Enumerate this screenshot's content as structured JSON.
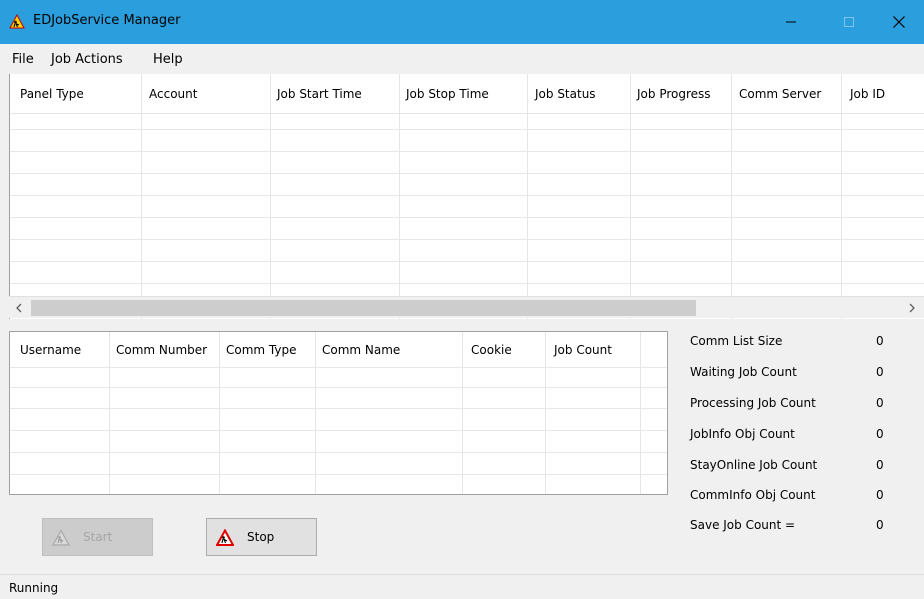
{
  "window": {
    "title": "EDJobService Manager"
  },
  "menu": [
    "File",
    "Job Actions",
    "Help"
  ],
  "jobs_grid": {
    "columns": [
      "Panel Type",
      "Account",
      "Job Start Time",
      "Job Stop Time",
      "Job Status",
      "Job Progress",
      "Comm Server",
      "Job ID"
    ],
    "rows": []
  },
  "comm_grid": {
    "columns": [
      "Username",
      "Comm Number",
      "Comm Type",
      "Comm Name",
      "Cookie",
      "Job Count"
    ],
    "rows": []
  },
  "stats": [
    {
      "label": "Comm List Size",
      "value": "0"
    },
    {
      "label": "Waiting Job Count",
      "value": "0"
    },
    {
      "label": "Processing Job Count",
      "value": "0"
    },
    {
      "label": "JobInfo Obj Count",
      "value": "0"
    },
    {
      "label": "StayOnline Job Count",
      "value": "0"
    },
    {
      "label": "CommInfo Obj Count",
      "value": "0"
    },
    {
      "label": "Save Job Count =",
      "value": "0"
    }
  ],
  "buttons": {
    "start_label": "Start",
    "stop_label": "Stop"
  },
  "status": {
    "text": "Running"
  },
  "colors": {
    "titlebar": "#2b9fdd",
    "window_bg": "#f0f0f0",
    "grid_bg": "#ffffff"
  }
}
